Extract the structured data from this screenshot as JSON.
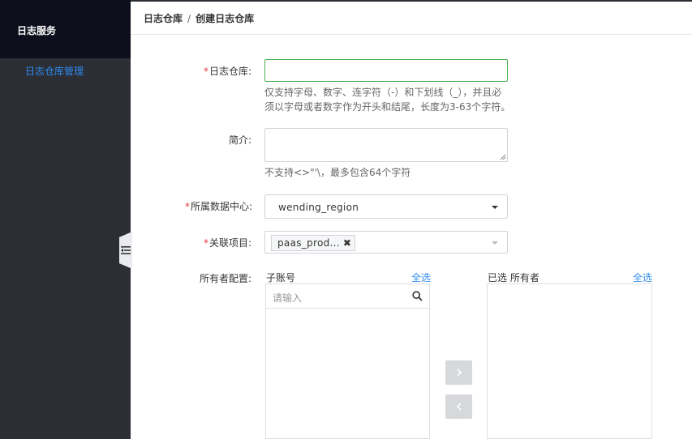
{
  "sidebar": {
    "title": "日志服务",
    "items": [
      {
        "label": "日志仓库管理",
        "active": true
      }
    ]
  },
  "breadcrumb": {
    "parent": "日志仓库",
    "separator": "/",
    "current": "创建日志仓库"
  },
  "form": {
    "repo_name": {
      "label": "日志仓库:",
      "required": true,
      "value": "",
      "hint": [
        "仅支持字母、数字、连字符（-）和下划线（_），并且必",
        "须以字母或者数字作为开头和结尾，长度为3-63个字符。"
      ]
    },
    "description": {
      "label": "简介:",
      "required": false,
      "value": "",
      "hint": "不支持<>\"'\\，最多包含64个字符"
    },
    "datacenter": {
      "label": "所属数据中心:",
      "required": true,
      "selected": "wending_region"
    },
    "project": {
      "label": "关联项目:",
      "required": true,
      "tags": [
        "paas_prod..."
      ]
    },
    "owner": {
      "label": "所有者配置:",
      "left_title": "子账号",
      "left_select_all": "全选",
      "search_placeholder": "请输入",
      "right_title": "已选 所有者",
      "right_select_all": "全选"
    }
  },
  "colors": {
    "accent": "#2e8cf0",
    "required": "#e4393c",
    "sidebar_bg": "#2b2e35",
    "sidebar_header_bg": "#0e0f1d",
    "focus": "#4caf50"
  },
  "icons": {
    "collapse": "collapse-sidebar-icon",
    "search": "search-icon",
    "move_right": "chevron-right-icon",
    "move_left": "chevron-left-icon"
  }
}
